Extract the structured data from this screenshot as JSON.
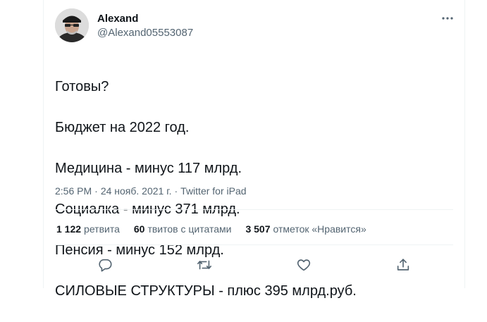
{
  "tweet": {
    "author_name": "Alexand",
    "author_handle": "@Alexand05553087",
    "text_lines": [
      "Готовы?",
      "Бюджет на 2022 год.",
      "Медицина - минус 117 млрд.",
      "Социалка - минус 371 млрд.",
      "Пенсия - минус 152 млрд.",
      "СИЛОВЫЕ СТРУКТУРЫ - плюс 395 млрд.руб."
    ],
    "time": "2:56 PM",
    "separator": "·",
    "date": "24 нояб. 2021 г.",
    "source": "Twitter for iPad"
  },
  "stats": {
    "retweets_count": "1 122",
    "retweets_label": "ретвита",
    "quotes_count": "60",
    "quotes_label": "твитов с цитатами",
    "likes_count": "3 507",
    "likes_label": "отметок «Нравится»"
  },
  "icons": {
    "more": "more-horizontal-icon",
    "reply": "reply-icon",
    "retweet": "retweet-icon",
    "like": "heart-icon",
    "share": "share-icon"
  },
  "colors": {
    "text": "#0f1419",
    "secondary": "#536471",
    "border": "#eff3f4"
  }
}
